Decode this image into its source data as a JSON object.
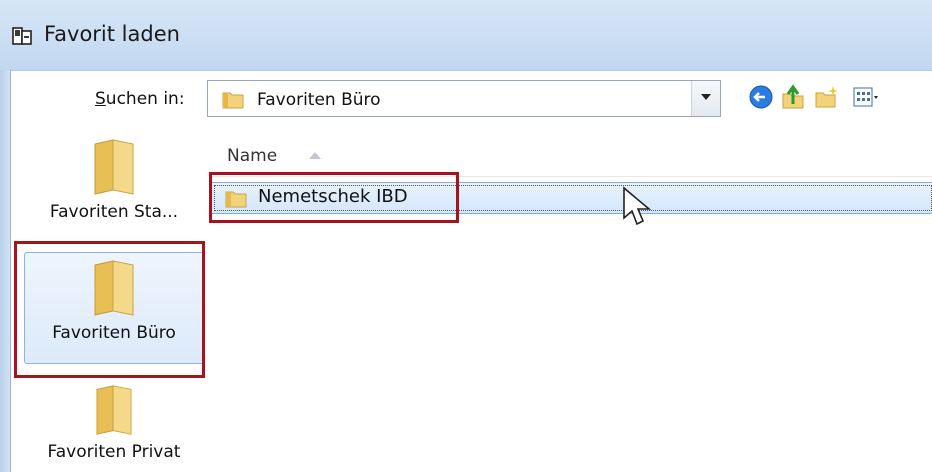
{
  "window": {
    "title": "Favorit laden"
  },
  "lookin": {
    "label_underlined": "S",
    "label_rest": "uchen in:",
    "value": "Favoriten Büro"
  },
  "toolbar": {
    "icons": [
      "back-icon",
      "up-folder-icon",
      "new-folder-icon",
      "views-menu-icon"
    ]
  },
  "filelist": {
    "column_name": "Name",
    "sort": "ascending",
    "rows": [
      {
        "name": "Nemetschek IBD",
        "selected": true
      }
    ]
  },
  "places": [
    {
      "label": "Favoriten Sta..."
    },
    {
      "label": "Favoriten Büro",
      "selected": true
    },
    {
      "label": "Favoriten Privat"
    }
  ],
  "colors": {
    "highlight_box": "#a4141c",
    "selection": "#d4e7fb",
    "titlebar": "#c9dcf2"
  }
}
